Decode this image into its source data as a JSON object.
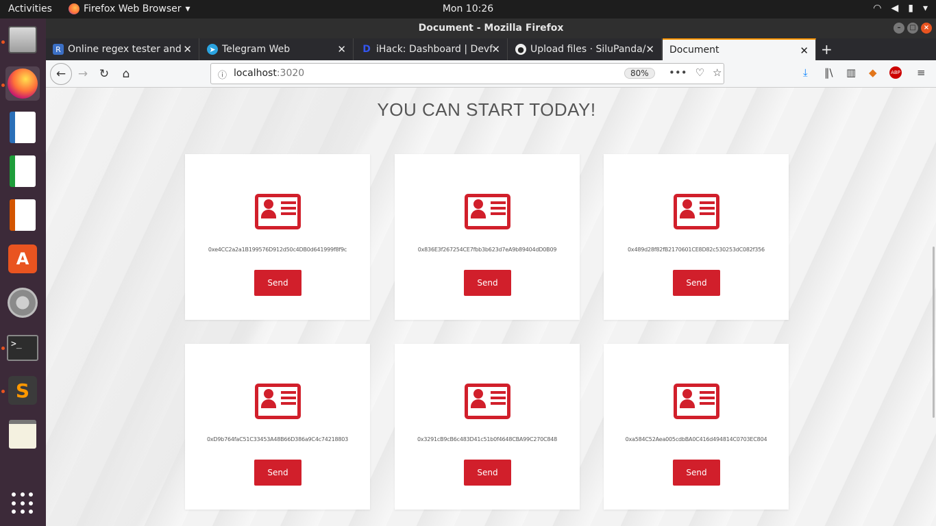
{
  "topbar": {
    "activities": "Activities",
    "app_name": "Firefox Web Browser",
    "clock": "Mon 10:26"
  },
  "window": {
    "title": "Document - Mozilla Firefox"
  },
  "tabs": [
    {
      "title": "Online regex tester and d",
      "favicon": "R",
      "favicon_color": "#3b6fc5"
    },
    {
      "title": "Telegram Web",
      "favicon": "➤",
      "favicon_color": "#2aa3e0"
    },
    {
      "title": "iHack: Dashboard | Devfo",
      "favicon": "D",
      "favicon_color": "#3355ee"
    },
    {
      "title": "Upload files · SiluPanda/",
      "favicon": "●",
      "favicon_color": "#222222"
    },
    {
      "title": "Document",
      "favicon": "",
      "favicon_color": ""
    }
  ],
  "navbar": {
    "url_host": "localhost",
    "url_port": ":3020",
    "zoom": "80%"
  },
  "page": {
    "headline": "YOU CAN START TODAY!",
    "accent_color": "#d11f2b",
    "cards": [
      {
        "address": "0xe4CC2a2a1B199576D912d50c4DB0d641999f8f9c",
        "button": "Send"
      },
      {
        "address": "0x836E3f267254CE7fbb3b623d7eA9b89404dD0B09",
        "button": "Send"
      },
      {
        "address": "0x489d28f82fB2170601CE8D82c530253dC082f356",
        "button": "Send"
      },
      {
        "address": "0xD9b764faC51C33453A48B66D386a9C4c74218803",
        "button": "Send"
      },
      {
        "address": "0x3291cB9cB6c483D41c51b0f4648CBA99C270C848",
        "button": "Send"
      },
      {
        "address": "0xa584C52Aea005cdbBA0C416d494814C0703EC804",
        "button": "Send"
      }
    ]
  }
}
